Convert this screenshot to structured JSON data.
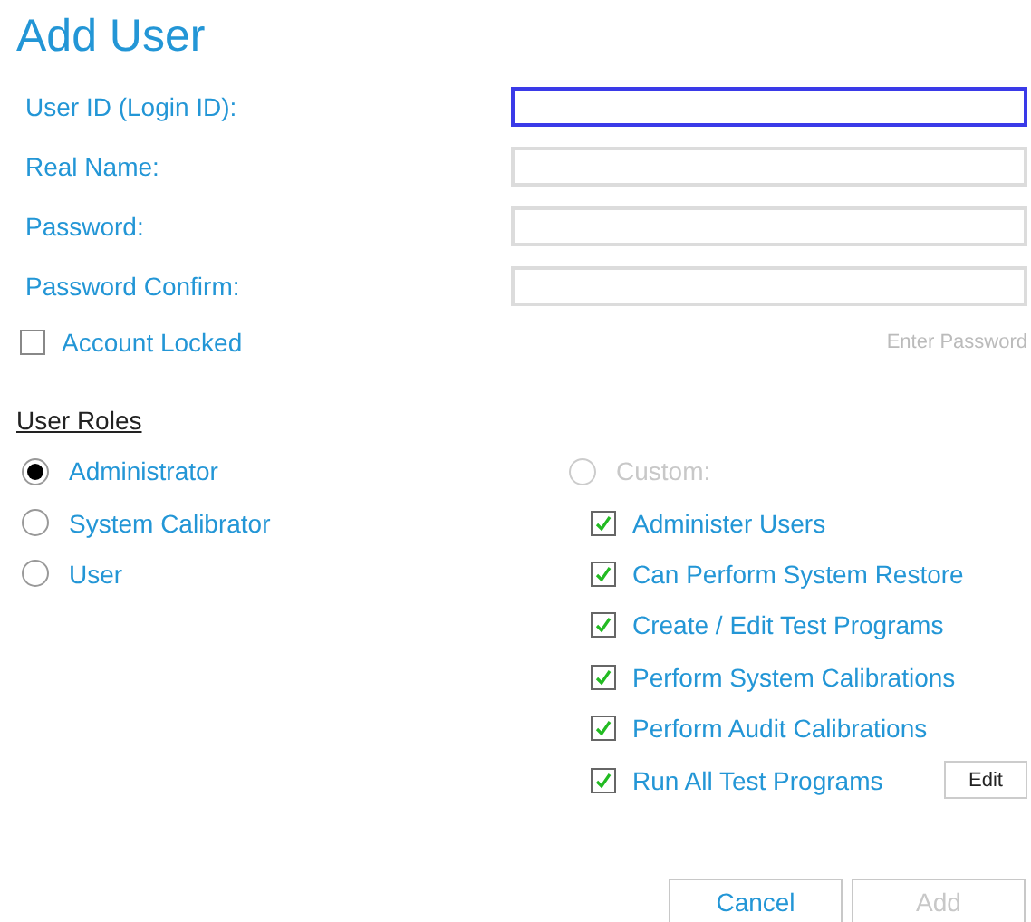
{
  "title": "Add User",
  "fields": [
    {
      "label": "User ID (Login ID):",
      "focused": true
    },
    {
      "label": "Real Name:",
      "focused": false
    },
    {
      "label": "Password:",
      "focused": false
    },
    {
      "label": "Password Confirm:",
      "focused": false
    }
  ],
  "account_locked": {
    "label": "Account Locked",
    "checked": false
  },
  "hint": "Enter Password",
  "roles_heading": "User Roles",
  "roles": [
    {
      "label": "Administrator",
      "selected": true
    },
    {
      "label": "System Calibrator",
      "selected": false
    },
    {
      "label": "User",
      "selected": false
    }
  ],
  "custom": {
    "label": "Custom:",
    "selected": false,
    "disabled": true
  },
  "permissions": [
    {
      "label": "Administer Users",
      "checked": true
    },
    {
      "label": "Can Perform System Restore",
      "checked": true
    },
    {
      "label": "Create / Edit Test Programs",
      "checked": true
    },
    {
      "label": "Perform System Calibrations",
      "checked": true
    },
    {
      "label": "Perform Audit Calibrations",
      "checked": true
    },
    {
      "label": "Run All Test Programs",
      "checked": true
    }
  ],
  "edit_button": "Edit",
  "buttons": [
    {
      "label": "Cancel",
      "disabled": false
    },
    {
      "label": "Add",
      "disabled": true
    }
  ]
}
